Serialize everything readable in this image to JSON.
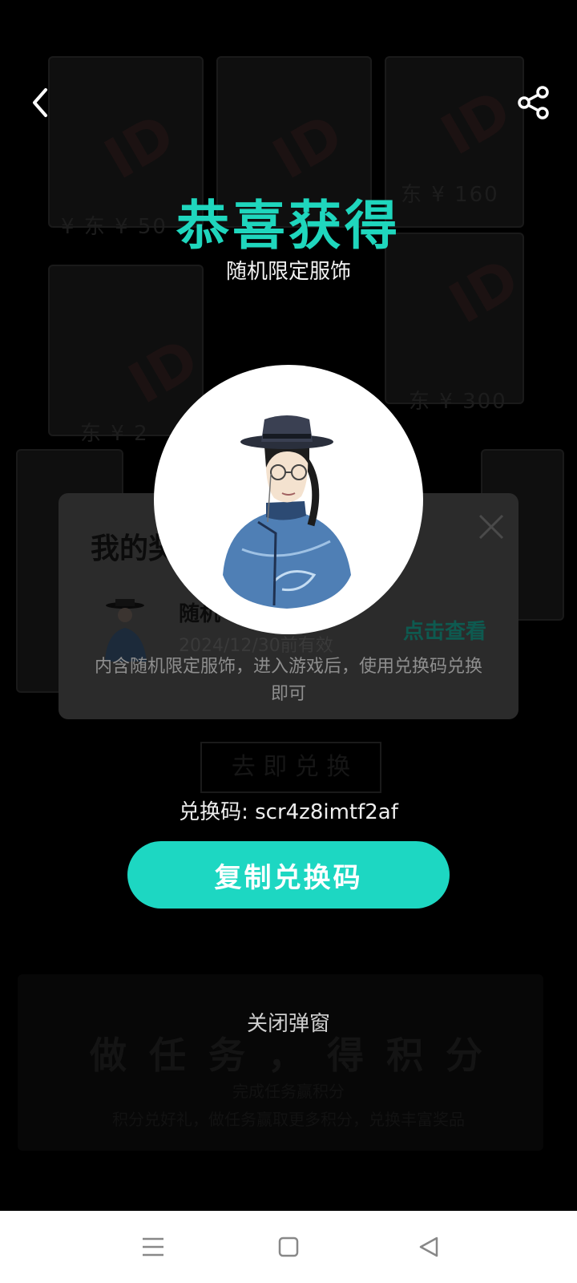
{
  "header": {
    "back_icon": "chevron-left-icon",
    "share_icon": "share-icon"
  },
  "congrats": {
    "title": "恭喜获得",
    "subtitle": "随机限定服饰"
  },
  "background": {
    "card_mark": "ID",
    "prices": [
      "¥ 东 ¥ 50",
      "东 ¥ 160",
      "东 ¥ 300",
      "东 ¥ 2"
    ],
    "button_label": "去 即 兑 换",
    "slogan": "做 任 务 ， 得 积 分",
    "lines": [
      "完成任务赢积分",
      "积分兑好礼，做任务赢取更多积分，兑换丰富奖品"
    ]
  },
  "prize_dialog": {
    "heading": "我的奖",
    "item_name": "随机",
    "item_date": "2024/12/30前有效",
    "view_link": "点击查看",
    "description": "内含随机限定服饰，进入游戏后，使用兑换码兑换即可"
  },
  "redeem": {
    "code_label": "兑换码: scr4z8imtf2af",
    "copy_button": "复制兑换码",
    "close_popup": "关闭弹窗"
  },
  "system_nav": {
    "menu_icon": "menu-icon",
    "home_icon": "home-square-icon",
    "back_icon": "back-triangle-icon"
  },
  "colors": {
    "accent": "#1fd6bd",
    "button": "#1dd7c2",
    "overlay": "#000000"
  }
}
